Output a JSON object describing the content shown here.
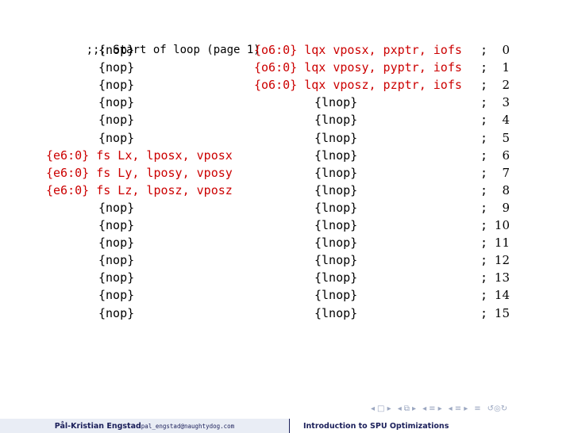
{
  "code": {
    "header": ";;; Start of loop (page 1)",
    "rows": [
      {
        "left": "{nop}",
        "left_active": false,
        "right": "{o6:0} lqx vposx, pxptr, iofs",
        "right_active": true,
        "sep": ";",
        "cycle": "0"
      },
      {
        "left": "{nop}",
        "left_active": false,
        "right": "{o6:0} lqx vposy, pyptr, iofs",
        "right_active": true,
        "sep": ";",
        "cycle": "1"
      },
      {
        "left": "{nop}",
        "left_active": false,
        "right": "{o6:0} lqx vposz, pzptr, iofs",
        "right_active": true,
        "sep": ";",
        "cycle": "2"
      },
      {
        "left": "{nop}",
        "left_active": false,
        "right": "{lnop}",
        "right_active": false,
        "sep": ";",
        "cycle": "3"
      },
      {
        "left": "{nop}",
        "left_active": false,
        "right": "{lnop}",
        "right_active": false,
        "sep": ";",
        "cycle": "4"
      },
      {
        "left": "{nop}",
        "left_active": false,
        "right": "{lnop}",
        "right_active": false,
        "sep": ";",
        "cycle": "5"
      },
      {
        "left": "{e6:0} fs Lx, lposx, vposx",
        "left_active": true,
        "right": "{lnop}",
        "right_active": false,
        "sep": ";",
        "cycle": "6"
      },
      {
        "left": "{e6:0} fs Ly, lposy, vposy",
        "left_active": true,
        "right": "{lnop}",
        "right_active": false,
        "sep": ";",
        "cycle": "7"
      },
      {
        "left": "{e6:0} fs Lz, lposz, vposz",
        "left_active": true,
        "right": "{lnop}",
        "right_active": false,
        "sep": ";",
        "cycle": "8"
      },
      {
        "left": "{nop}",
        "left_active": false,
        "right": "{lnop}",
        "right_active": false,
        "sep": ";",
        "cycle": "9"
      },
      {
        "left": "{nop}",
        "left_active": false,
        "right": "{lnop}",
        "right_active": false,
        "sep": ";",
        "cycle": "10"
      },
      {
        "left": "{nop}",
        "left_active": false,
        "right": "{lnop}",
        "right_active": false,
        "sep": ";",
        "cycle": "11"
      },
      {
        "left": "{nop}",
        "left_active": false,
        "right": "{lnop}",
        "right_active": false,
        "sep": ";",
        "cycle": "12"
      },
      {
        "left": "{nop}",
        "left_active": false,
        "right": "{lnop}",
        "right_active": false,
        "sep": ";",
        "cycle": "13"
      },
      {
        "left": "{nop}",
        "left_active": false,
        "right": "{lnop}",
        "right_active": false,
        "sep": ";",
        "cycle": "14"
      },
      {
        "left": "{nop}",
        "left_active": false,
        "right": "{lnop}",
        "right_active": false,
        "sep": ";",
        "cycle": "15"
      }
    ]
  },
  "footer": {
    "author": "Pål-Kristian Engstad",
    "email": "pal_engstad@naughtydog.com",
    "title": "Introduction to SPU Optimizations"
  },
  "nav": {
    "icons": [
      "nav-slide-prev-icon",
      "nav-slide-next-icon",
      "nav-frame-prev-icon",
      "nav-frame-next-icon",
      "nav-subsection-prev-icon",
      "nav-subsection-next-icon",
      "nav-section-prev-icon",
      "nav-section-next-icon",
      "nav-align-icon",
      "nav-search-icon"
    ]
  },
  "colors": {
    "active_instruction": "#cc0000",
    "footer_text": "#1b1f5a",
    "footer_left_bg": "#e9edf5"
  }
}
